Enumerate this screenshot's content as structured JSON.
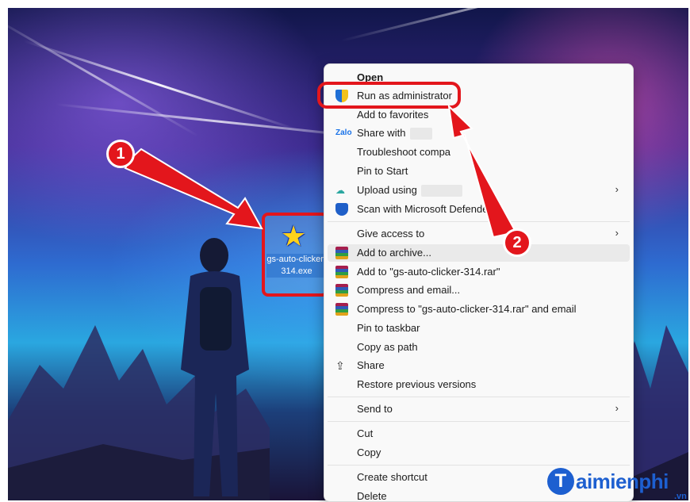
{
  "desktop": {
    "file_icon": {
      "name": "gs-auto-clicker-314.exe",
      "icon": "star-icon"
    }
  },
  "context_menu": {
    "items": [
      {
        "label": "Open",
        "icon": "",
        "submenu": false
      },
      {
        "label": "Run as administrator",
        "icon": "uac-shield-icon",
        "submenu": false
      },
      {
        "label": "Add to favorites",
        "icon": "",
        "submenu": false
      },
      {
        "label": "Share with",
        "icon": "share-with-icon",
        "submenu": false
      },
      {
        "label": "Troubleshoot compa",
        "icon": "",
        "submenu": false
      },
      {
        "label": "Pin to Start",
        "icon": "",
        "submenu": false
      },
      {
        "label": "Upload using",
        "icon": "upload-icon",
        "submenu": true
      },
      {
        "label": "Scan with Microsoft Defender...",
        "icon": "defender-icon",
        "submenu": false
      },
      {
        "label": "Give access to",
        "icon": "",
        "submenu": true
      },
      {
        "label": "Add to archive...",
        "icon": "winrar-icon",
        "submenu": false
      },
      {
        "label": "Add to \"gs-auto-clicker-314.rar\"",
        "icon": "winrar-icon",
        "submenu": false
      },
      {
        "label": "Compress and email...",
        "icon": "winrar-icon",
        "submenu": false
      },
      {
        "label": "Compress to \"gs-auto-clicker-314.rar\" and email",
        "icon": "winrar-icon",
        "submenu": false
      },
      {
        "label": "Pin to taskbar",
        "icon": "",
        "submenu": false
      },
      {
        "label": "Copy as path",
        "icon": "",
        "submenu": false
      },
      {
        "label": "Share",
        "icon": "share-icon",
        "submenu": false
      },
      {
        "label": "Restore previous versions",
        "icon": "",
        "submenu": false
      },
      {
        "label": "Send to",
        "icon": "",
        "submenu": true
      },
      {
        "label": "Cut",
        "icon": "",
        "submenu": false
      },
      {
        "label": "Copy",
        "icon": "",
        "submenu": false
      },
      {
        "label": "Create shortcut",
        "icon": "",
        "submenu": false
      },
      {
        "label": "Delete",
        "icon": "",
        "submenu": false
      }
    ],
    "chevron": "›"
  },
  "annotations": {
    "step1": "1",
    "step2": "2",
    "accent_color": "#e3161c"
  },
  "watermark": {
    "letter": "T",
    "text": "aimienphi",
    "suffix": ".vn"
  }
}
